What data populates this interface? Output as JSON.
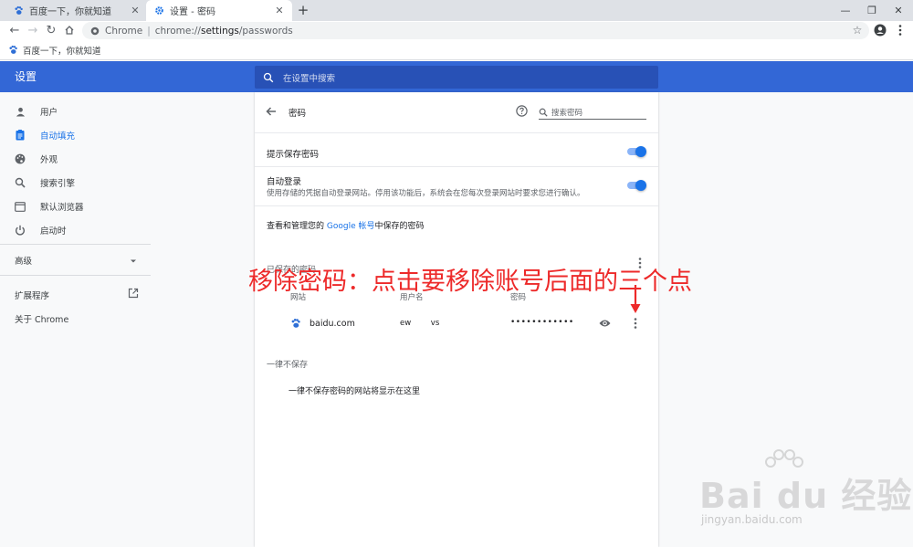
{
  "tabs": [
    {
      "title": "百度一下，你就知道"
    },
    {
      "title": "设置 - 密码"
    }
  ],
  "toolbar": {
    "origin_label": "Chrome",
    "url_prefix": "chrome://",
    "url_host": "settings",
    "url_path": "/passwords"
  },
  "bookmarks": [
    {
      "label": "百度一下，你就知道"
    }
  ],
  "header": {
    "title": "设置",
    "search_placeholder": "在设置中搜索"
  },
  "sidebar": {
    "items": [
      {
        "label": "用户",
        "icon": "person-icon"
      },
      {
        "label": "自动填充",
        "icon": "autofill-icon",
        "selected": true
      },
      {
        "label": "外观",
        "icon": "palette-icon"
      },
      {
        "label": "搜索引擎",
        "icon": "search-icon"
      },
      {
        "label": "默认浏览器",
        "icon": "browser-icon"
      },
      {
        "label": "启动时",
        "icon": "power-icon"
      }
    ],
    "advanced": "高级",
    "extensions": "扩展程序",
    "about": "关于 Chrome"
  },
  "passwords": {
    "title": "密码",
    "search_placeholder": "搜索密码",
    "offer_save": {
      "label": "提示保存密码",
      "enabled": true
    },
    "auto_signin": {
      "label": "自动登录",
      "description": "使用存储的凭据自动登录网站。停用该功能后，系统会在您每次登录网站时要求您进行确认。",
      "enabled": true
    },
    "google_line": {
      "before": "查看和管理您的 ",
      "link": "Google 帐号",
      "after": "中保存的密码"
    },
    "saved_title": "已保存的密码",
    "columns": {
      "site": "网站",
      "username": "用户名",
      "password": "密码"
    },
    "rows": [
      {
        "site": "baidu.com",
        "username": "ew        vs",
        "password": "••••••••••••"
      }
    ],
    "never_saved_title": "一律不保存",
    "never_saved_empty": "一律不保存密码的网站将显示在这里"
  },
  "annotation": {
    "text": "移除密码：点击要移除账号后面的三个点",
    "color": "#ed2a2a"
  },
  "watermark": {
    "main": "Bai du 经验",
    "sub": "jingyan.baidu.com"
  },
  "colors": {
    "header": "#3367d6",
    "accent": "#1a73e8"
  }
}
